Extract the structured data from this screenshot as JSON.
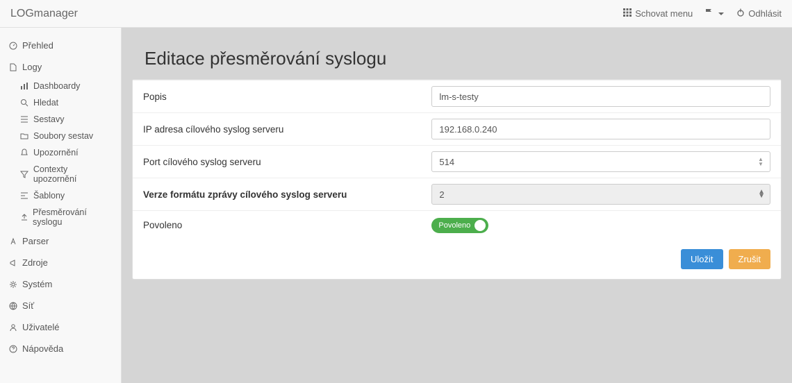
{
  "topbar": {
    "brand": "LOGmanager",
    "hide_menu": "Schovat menu",
    "logout": "Odhlásit"
  },
  "sidebar": {
    "overview": "Přehled",
    "logs": "Logy",
    "subs": {
      "dashboards": "Dashboardy",
      "search": "Hledat",
      "reports": "Sestavy",
      "report_files": "Soubory sestav",
      "alerts": "Upozornění",
      "alert_contexts": "Contexty upozornění",
      "templates": "Šablony",
      "syslog_fwd": "Přesměrování syslogu"
    },
    "parser": "Parser",
    "sources": "Zdroje",
    "system": "Systém",
    "network": "Síť",
    "users": "Uživatelé",
    "help": "Nápověda"
  },
  "page": {
    "title": "Editace přesměrování syslogu",
    "labels": {
      "desc": "Popis",
      "ip": "IP adresa cílového syslog serveru",
      "port": "Port cílového syslog serveru",
      "version": "Verze formátu zprávy cílového syslog serveru",
      "enabled": "Povoleno"
    },
    "values": {
      "desc": "lm-s-testy",
      "ip": "192.168.0.240",
      "port": "514",
      "version": "2",
      "enabled_label": "Povoleno"
    },
    "buttons": {
      "save": "Uložit",
      "cancel": "Zrušit"
    }
  }
}
